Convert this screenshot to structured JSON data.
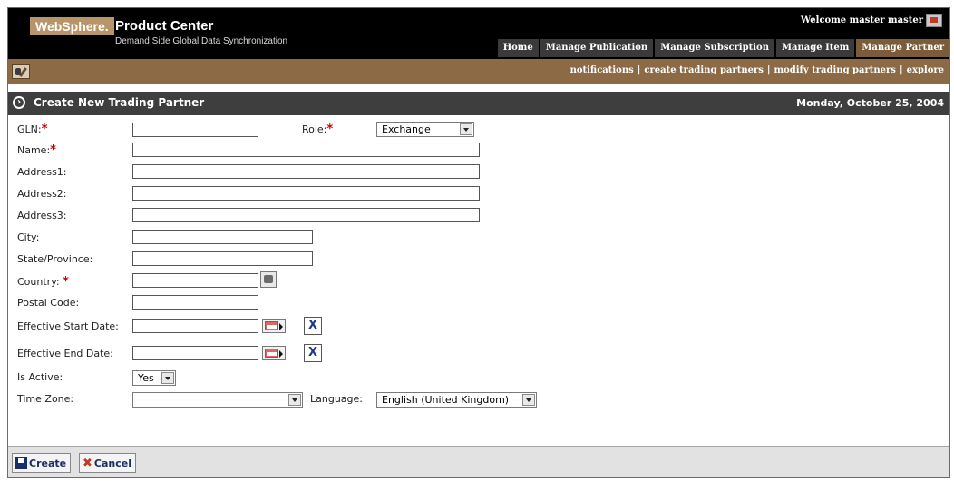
{
  "header": {
    "brand": "WebSphere.",
    "product_title": "Product Center",
    "product_subtitle": "Demand Side Global Data Synchronization",
    "welcome": "Welcome master master",
    "tabs": [
      "Home",
      "Manage Publication",
      "Manage Subscription",
      "Manage Item",
      "Manage Partner"
    ],
    "active_tab": "Manage Partner"
  },
  "subnav": {
    "links": [
      "notifications",
      "create trading partners",
      "modify trading partners",
      "explore"
    ],
    "current": "create trading partners",
    "separator": "|"
  },
  "page": {
    "title": "Create New Trading Partner",
    "date": "Monday, October 25, 2004"
  },
  "form": {
    "gln_label": "GLN:",
    "gln_value": "",
    "role_label": "Role:",
    "role_value": "Exchange",
    "name_label": "Name:",
    "address1_label": "Address1:",
    "address2_label": "Address2:",
    "address3_label": "Address3:",
    "city_label": "City:",
    "state_label": "State/Province:",
    "country_label": "Country:",
    "postal_label": "Postal Code:",
    "start_date_label": "Effective Start Date:",
    "end_date_label": "Effective End Date:",
    "clear_label": "X",
    "active_label": "Is Active:",
    "active_value": "Yes",
    "timezone_label": "Time Zone:",
    "timezone_value": "",
    "language_label": "Language:",
    "language_value": "English (United Kingdom)",
    "required_mark": "*"
  },
  "footer": {
    "create_label": "Create",
    "cancel_label": "Cancel"
  },
  "colors": {
    "header_bg": "#000000",
    "subnav_bg": "#8b6a45",
    "titlebar_bg": "#3e3e3e",
    "required": "#cc0000",
    "active_tab": "#7a5c3a"
  }
}
